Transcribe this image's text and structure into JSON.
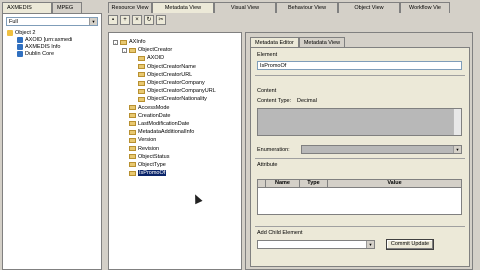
{
  "left_tabs": [
    "AXMEDIS",
    "MPEG"
  ],
  "left_select": "Full",
  "left_tree": [
    {
      "label": "Object 2",
      "color": "#f0c040"
    },
    {
      "label": "AXOID [urn:axmedi",
      "color": "#3070c0"
    },
    {
      "label": "AXMEDIS Info",
      "color": "#3070c0"
    },
    {
      "label": "Dublin Core",
      "color": "#3070c0"
    }
  ],
  "right_tabs": [
    "Resource View",
    "Metadata View",
    "Visual View",
    "Behaviour View",
    "Object View",
    "Workflow Vie"
  ],
  "toolbar_icons": [
    "save-icon",
    "new-icon",
    "delete-icon",
    "refresh-icon",
    "cut-icon"
  ],
  "tree": [
    {
      "label": "AXInfo",
      "depth": 0,
      "expander": "-"
    },
    {
      "label": "ObjectCreator",
      "depth": 1,
      "expander": "-"
    },
    {
      "label": "AXOID",
      "depth": 2
    },
    {
      "label": "ObjectCreatorName",
      "depth": 2
    },
    {
      "label": "ObjectCreatorURL",
      "depth": 2
    },
    {
      "label": "ObjectCreatorCompany",
      "depth": 2
    },
    {
      "label": "ObjectCreatorCompanyURL",
      "depth": 2
    },
    {
      "label": "ObjectCreatorNationality",
      "depth": 2
    },
    {
      "label": "AccessMode",
      "depth": 1
    },
    {
      "label": "CreationDate",
      "depth": 1
    },
    {
      "label": "LastModificationDate",
      "depth": 1
    },
    {
      "label": "MetadataAdditionalInfo",
      "depth": 1
    },
    {
      "label": "Version",
      "depth": 1
    },
    {
      "label": "Revision",
      "depth": 1
    },
    {
      "label": "ObjectStatus",
      "depth": 1
    },
    {
      "label": "ObjectType",
      "depth": 1
    },
    {
      "label": "IsPromoOf",
      "depth": 1,
      "selected": true
    }
  ],
  "editor": {
    "tabs": [
      "Metadata Editor",
      "Metadata View"
    ],
    "element_label": "Element",
    "element_value": "IsPromoOf",
    "content_label": "Content",
    "content_type_label": "Content Type:",
    "content_type_value": "Decimal",
    "enumeration_label": "Enumeration:",
    "attribute_label": "Attribute",
    "attr_headers": [
      "Name",
      "Type",
      "Value"
    ],
    "add_child_label": "Add Child Element",
    "commit_button": "Commit Update"
  }
}
